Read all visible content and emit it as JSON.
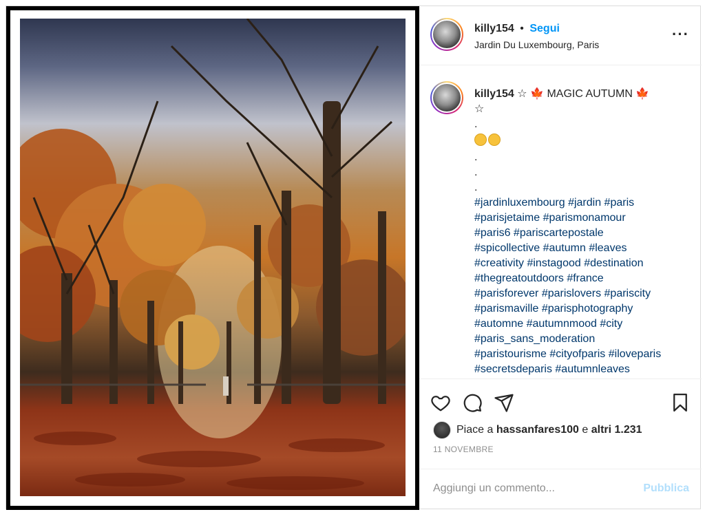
{
  "post": {
    "username": "killy154",
    "separator": "•",
    "follow_label": "Segui",
    "location": "Jardin Du Luxembourg, Paris",
    "more_icon": "···"
  },
  "caption": {
    "username": "killy154",
    "text_star": "☆",
    "text_leaf": "🍁",
    "text_title": "MAGIC AUTUMN",
    "dot": ".",
    "hashtags": [
      "#jardinluxembourg #jardin #paris",
      "#parisjetaime #parismonamour",
      "#paris6 #pariscartepostale",
      "#spicollective #autumn #leaves",
      "#creativity #instagood #destination",
      "#thegreatoutdoors #france",
      "#parisforever #parislovers #pariscity",
      "#parismaville #parisphotography",
      "#automne #autumnmood #city",
      "#paris_sans_moderation",
      "#paristourisme #cityofparis #iloveparis",
      "#secretsdeparis #autumnleaves"
    ]
  },
  "likes": {
    "prefix": "Piace a",
    "user": "hassanfares100",
    "middle": "e",
    "others": "altri 1.231"
  },
  "date": "11 NOVEMBRE",
  "comment": {
    "placeholder": "Aggiungi un commento...",
    "publish_label": "Pubblica"
  },
  "colors": {
    "link": "#00376b",
    "follow": "#0095f6",
    "publish_disabled": "#b2dffc"
  },
  "icons": [
    "heart-icon",
    "comment-icon",
    "share-icon",
    "bookmark-icon",
    "more-options-icon"
  ]
}
